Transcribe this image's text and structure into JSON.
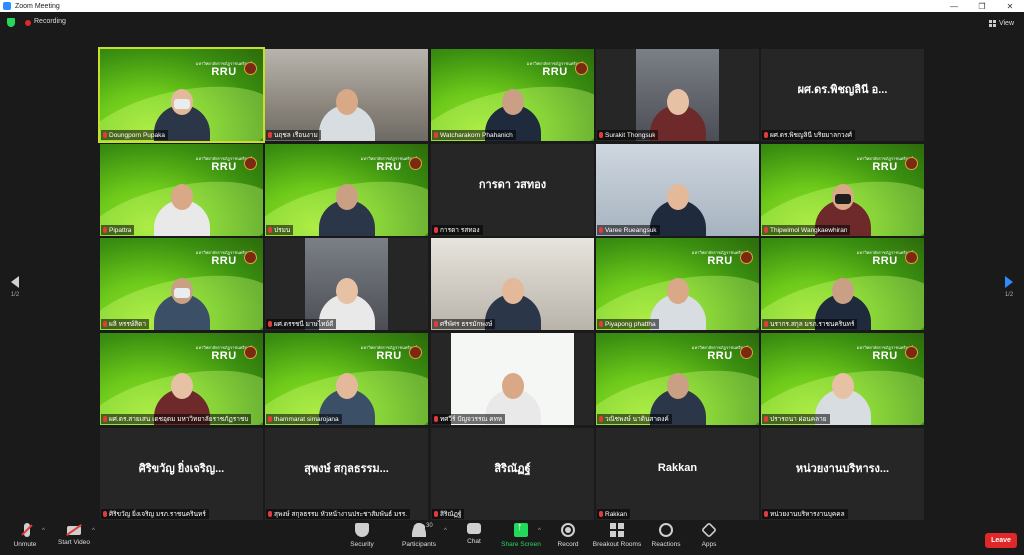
{
  "window": {
    "title": "Zoom Meeting",
    "controls": [
      "—",
      "❐",
      "✕"
    ]
  },
  "topbar": {
    "recording_label": "Recording",
    "view_label": "View"
  },
  "pager": {
    "left_page": "1/2",
    "right_page": "1/2"
  },
  "tiles": [
    {
      "name": "Doungporn Pupaka",
      "big": "",
      "kind": "rru"
    },
    {
      "name": "นฤชล  เรือนงาม",
      "big": "",
      "kind": "photo"
    },
    {
      "name": "Watcharakorn Phahanich",
      "big": "",
      "kind": "rru"
    },
    {
      "name": "Surakit Thongsuk",
      "big": "",
      "kind": "office"
    },
    {
      "name": "ผศ.ดร.พิชญลินี บริยมาลกวงศ์",
      "big": "ผศ.ดร.พิชญลินี อ...",
      "kind": "plain"
    },
    {
      "name": "Pipattra",
      "big": "",
      "kind": "rru"
    },
    {
      "name": "ปรมน",
      "big": "",
      "kind": "rru"
    },
    {
      "name": "การดา รสทอง",
      "big": "การดา วสทอง",
      "kind": "plain"
    },
    {
      "name": "Varee Rueangsuk",
      "big": "",
      "kind": "photo2"
    },
    {
      "name": "Thipwimol Wangkaewhiran",
      "big": "",
      "kind": "rru"
    },
    {
      "name": "ผลิ หรรษ์สิดา",
      "big": "",
      "kind": "rru"
    },
    {
      "name": "ผศ.ดรรชนี มาษไทย์ดี",
      "big": "",
      "kind": "office"
    },
    {
      "name": "ศรีพัศร ธรรมักพงษ์",
      "big": "",
      "kind": "photo3"
    },
    {
      "name": "Piyapong phattha",
      "big": "",
      "kind": "rru"
    },
    {
      "name": "นรากร.สกุล มรภ.ราชนครินทร์",
      "big": "",
      "kind": "rru"
    },
    {
      "name": "ผศ.ดร.สายเสน เดชอุดม มหาวิทยาลัยราชภัฏราชนครินทร์",
      "big": "",
      "kind": "rru"
    },
    {
      "name": "thammarat simarojana",
      "big": "",
      "kind": "rru"
    },
    {
      "name": "ทศวีร์ ปัญจวรรณ คทห",
      "big": "",
      "kind": "slide"
    },
    {
      "name": "วณิชพงษ์ นาดินสาดงค์",
      "big": "",
      "kind": "rru"
    },
    {
      "name": "ปรารถนา ผ่อนคลาย",
      "big": "",
      "kind": "rru"
    },
    {
      "name": "ศิริขวัญ  ยิ่งเจริญ  มรภ.ราชนครินทร์",
      "big": "ศิริขวัญ  ยิ่งเจริญ...",
      "kind": "plain"
    },
    {
      "name": "สุพงษ์ สกุลธรรม หัวหน้างานประชาสัมพันธ์ มรร.",
      "big": "สุพงษ์ สกุลธรรม...",
      "kind": "plain"
    },
    {
      "name": "สิริณัฏฐ์",
      "big": "สิริณัฏฐ์",
      "kind": "plain"
    },
    {
      "name": "Rakkan",
      "big": "Rakkan",
      "kind": "plain"
    },
    {
      "name": "หน่วยงานบริหารงานบุคคล",
      "big": "หน่วยงานบริหารง...",
      "kind": "plain"
    }
  ],
  "rru": {
    "line1": "มหาวิทยาลัยราชภัฏราชนครินทร์",
    "logo": "RRU"
  },
  "toolbar": {
    "unmute": "Unmute",
    "start_video": "Start Video",
    "security": "Security",
    "participants": "Participants",
    "participants_count": "30",
    "chat": "Chat",
    "share_screen": "Share Screen",
    "record": "Record",
    "breakout_rooms": "Breakout Rooms",
    "reactions": "Reactions",
    "apps": "Apps",
    "leave": "Leave"
  },
  "colors": {
    "active_border": "#c6e02d",
    "leave": "#e02828",
    "share": "#23d959",
    "accent": "#2d8cff"
  }
}
